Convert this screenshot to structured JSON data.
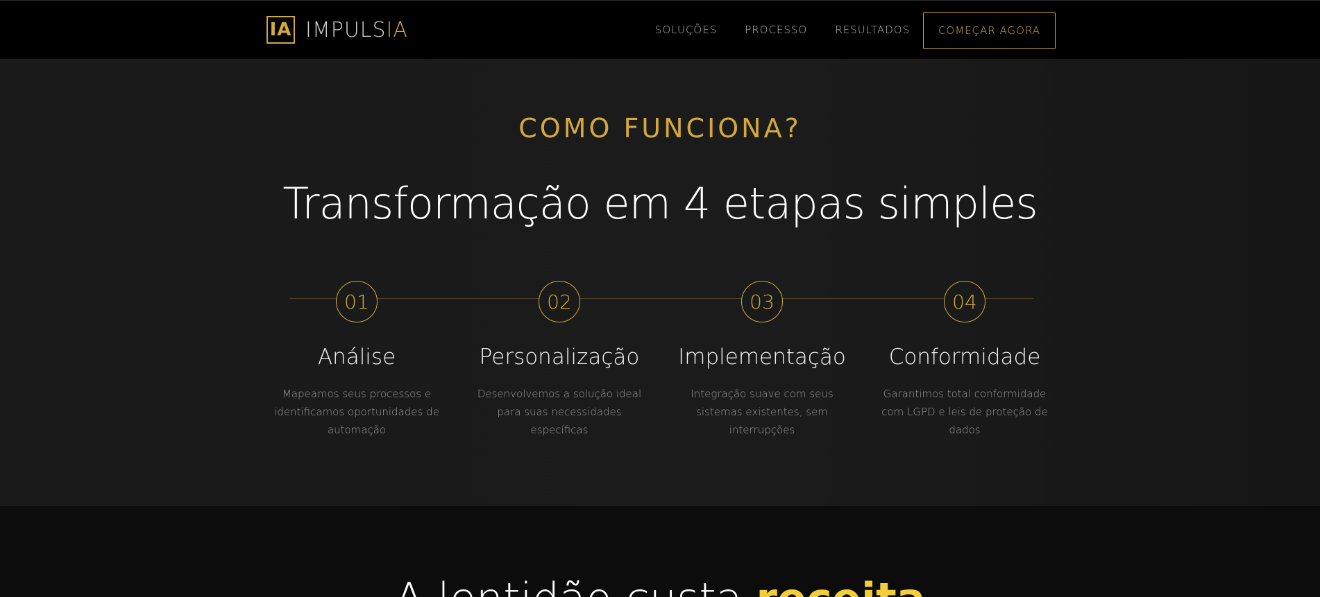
{
  "nav": {
    "logo_mark": "IA",
    "logo_text_main": "IMPULS",
    "logo_text_accent": "IA",
    "links": [
      {
        "label": "SOLUÇÕES"
      },
      {
        "label": "PROCESSO"
      },
      {
        "label": "RESULTADOS"
      }
    ],
    "cta_label": "COMEÇAR AGORA"
  },
  "how": {
    "eyebrow": "COMO FUNCIONA?",
    "headline": "Transformação em 4 etapas simples",
    "steps": [
      {
        "num": "01",
        "title": "Análise",
        "desc": "Mapeamos seus processos e identificamos oportunidades de automação"
      },
      {
        "num": "02",
        "title": "Personalização",
        "desc": "Desenvolvemos a solução ideal para suas necessidades específicas"
      },
      {
        "num": "03",
        "title": "Implementação",
        "desc": "Integração suave com seus sistemas existentes, sem interrupções"
      },
      {
        "num": "04",
        "title": "Conformidade",
        "desc": "Garantimos total conformidade com LGPD e leis de proteção de dados"
      }
    ]
  },
  "next": {
    "title_main": "A lentidão custa ",
    "title_highlight": "receita"
  },
  "colors": {
    "gold": "#d4a93c",
    "highlight_yellow": "#f2cf3a",
    "background": "#1a1a1a"
  }
}
